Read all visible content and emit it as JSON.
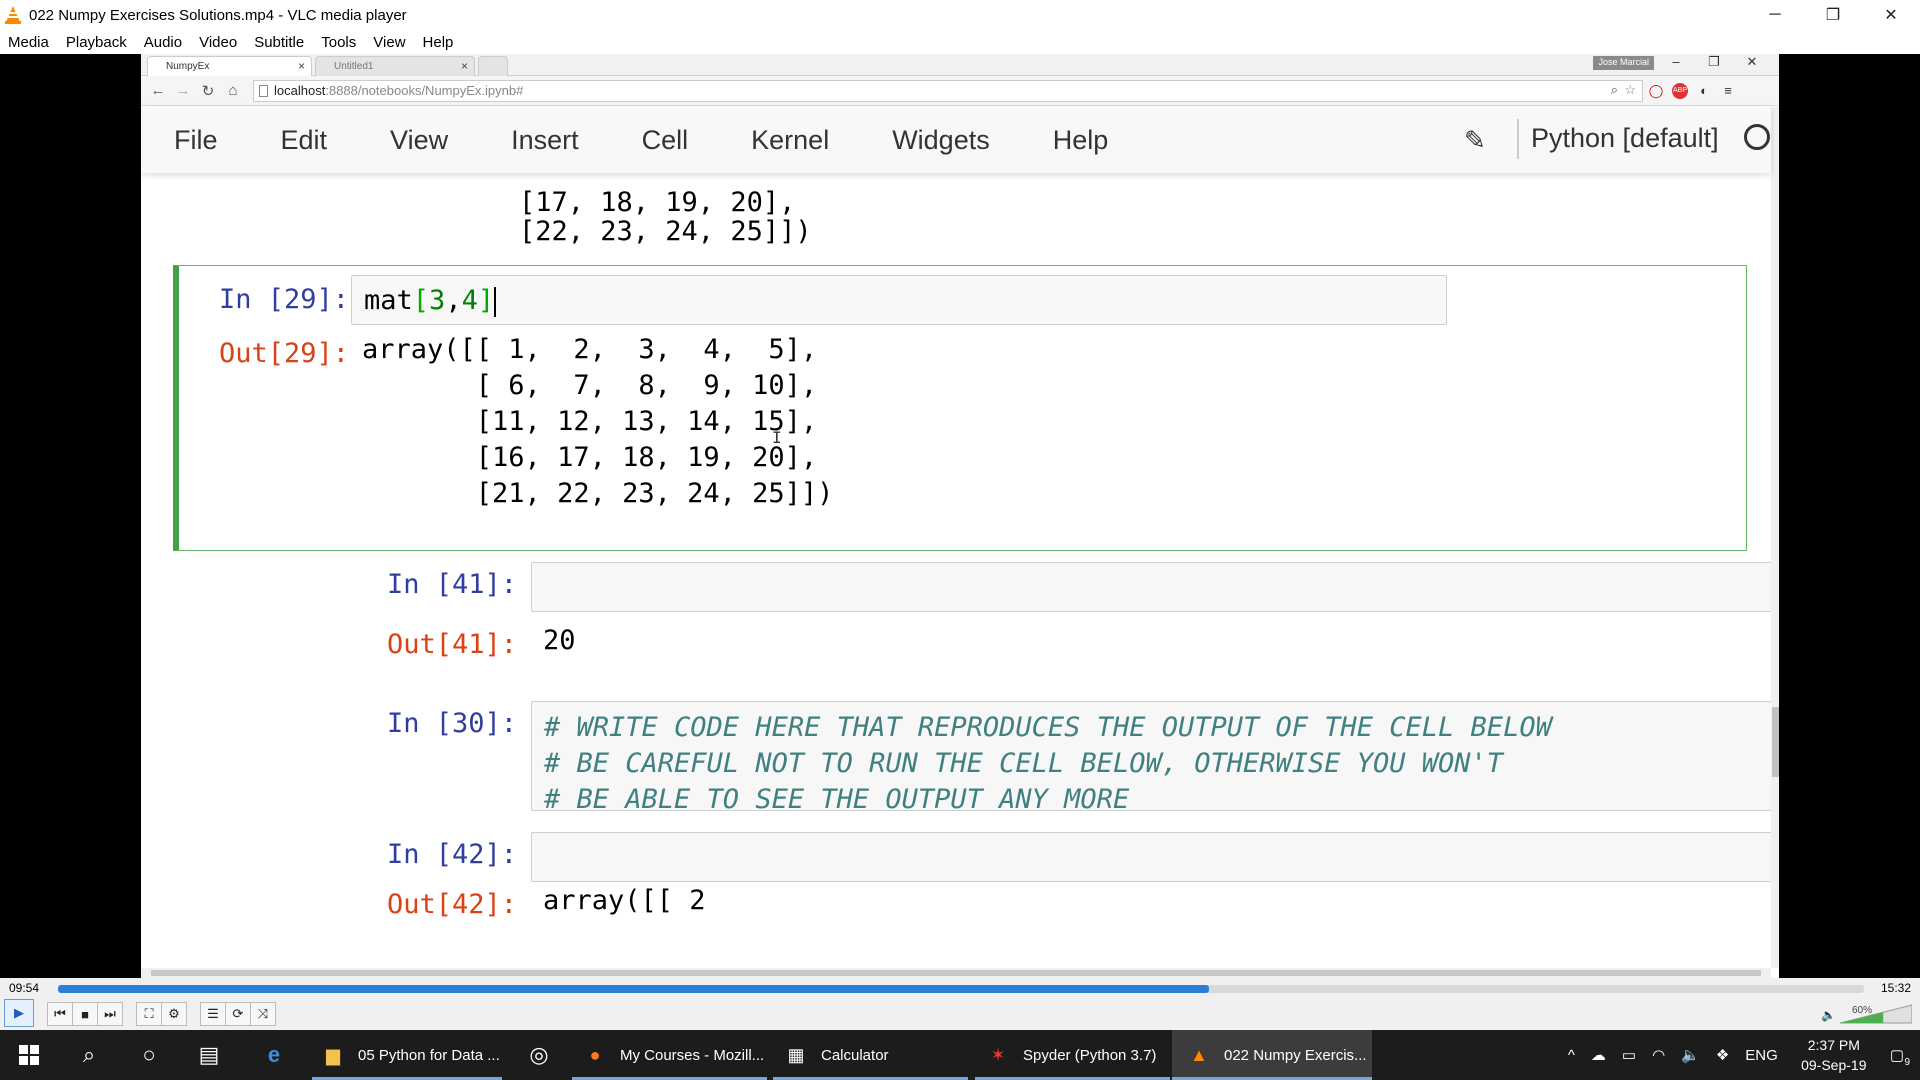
{
  "window": {
    "title": "022 Numpy Exercises Solutions.mp4 - VLC media player",
    "minimize": "─",
    "restore": "❐",
    "close": "✕"
  },
  "vlc_menu": [
    "Media",
    "Playback",
    "Audio",
    "Video",
    "Subtitle",
    "Tools",
    "View",
    "Help"
  ],
  "browser": {
    "tabs": [
      {
        "label": "NumpyEx",
        "close": "×"
      },
      {
        "label": "Untitled1",
        "close": "×"
      }
    ],
    "profile_badge": "Jose Marcial",
    "window_buttons": [
      "–",
      "❐",
      "✕"
    ],
    "url_host": "localhost",
    "url_rest": ":8888/notebooks/NumpyEx.ipynb#"
  },
  "jupyter": {
    "menu": [
      "File",
      "Edit",
      "View",
      "Insert",
      "Cell",
      "Kernel",
      "Widgets",
      "Help"
    ],
    "kernel_name": "Python [default]"
  },
  "notebook": {
    "prev_output_lines": [
      "[17, 18, 19, 20],",
      "[22, 23, 24, 25]])"
    ],
    "cells": [
      {
        "in_prompt": "In [29]:",
        "code_prefix": "mat",
        "code_open": "[",
        "code_a": "3",
        "code_comma": ",",
        "code_b": "4",
        "code_close": "]",
        "out_prompt": "Out[29]:",
        "output_lines": [
          "array([[ 1,  2,  3,  4,  5],",
          "       [ 6,  7,  8,  9, 10],",
          "       [11, 12, 13, 14, 15],",
          "       [16, 17, 18, 19, 20],",
          "       [21, 22, 23, 24, 25]])"
        ]
      },
      {
        "in_prompt": "In [41]:",
        "out_prompt": "Out[41]:",
        "output": "20"
      },
      {
        "in_prompt": "In [30]:",
        "comment_lines": [
          "# WRITE CODE HERE THAT REPRODUCES THE OUTPUT OF THE CELL BELOW",
          "# BE CAREFUL NOT TO RUN THE CELL BELOW, OTHERWISE YOU WON'T",
          "# BE ABLE TO SEE THE OUTPUT ANY MORE"
        ]
      },
      {
        "in_prompt": "In [42]:",
        "out_prompt_partial": "Out[42]:",
        "output_partial": "array([[ 2"
      }
    ]
  },
  "player": {
    "time_elapsed": "09:54",
    "time_total": "15:32",
    "progress_fraction": 0.6373,
    "volume": "60%"
  },
  "taskbar": {
    "apps": [
      {
        "label": "05 Python for Data ..."
      },
      {
        "label": "My Courses - Mozill..."
      },
      {
        "label": "Calculator"
      },
      {
        "label": "Spyder (Python 3.7)"
      },
      {
        "label": "022 Numpy Exercis..."
      }
    ],
    "language": "ENG",
    "time": "2:37 PM",
    "date": "09-Sep-19",
    "notifications": "9"
  }
}
